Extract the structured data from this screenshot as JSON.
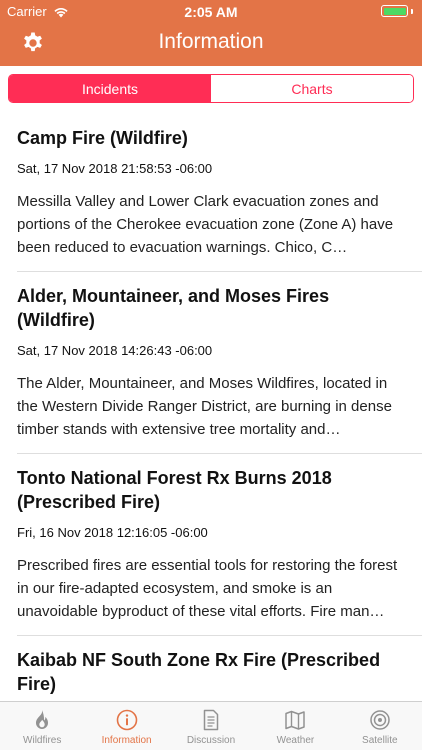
{
  "status_bar": {
    "carrier": "Carrier",
    "time": "2:05 AM",
    "battery_level": 1.0
  },
  "nav": {
    "title": "Information",
    "settings_icon": "gear-icon"
  },
  "segments": [
    {
      "label": "Incidents",
      "active": true
    },
    {
      "label": "Charts",
      "active": false
    }
  ],
  "incidents": [
    {
      "title": "Camp Fire (Wildfire)",
      "date": "Sat, 17 Nov 2018 21:58:53 -06:00",
      "description": " Messilla Valley and Lower Clark evacuation zones and portions of the Cherokee evacuation zone (Zone A) have been reduced to evacuation warnings. Chico, C…"
    },
    {
      "title": "Alder, Mountaineer, and Moses Fires (Wildfire)",
      "date": "Sat, 17 Nov 2018 14:26:43 -06:00",
      "description": "The Alder, Mountaineer, and Moses Wildfires, located in the Western Divide Ranger District, are burning in dense timber stands with extensive tree mortality and…"
    },
    {
      "title": "Tonto National Forest Rx Burns 2018 (Prescribed Fire)",
      "date": "Fri, 16 Nov 2018 12:16:05 -06:00",
      "description": "Prescribed fires are essential tools for restoring the forest in our fire-adapted ecosystem, and smoke is an unavoidable byproduct of these vital efforts. Fire man…"
    },
    {
      "title": "Kaibab NF South Zone Rx Fire (Prescribed Fire)",
      "date": "",
      "description": ""
    }
  ],
  "tabs": [
    {
      "label": "Wildfires",
      "icon": "flame-icon",
      "active": false
    },
    {
      "label": "Information",
      "icon": "info-icon",
      "active": true
    },
    {
      "label": "Discussion",
      "icon": "document-icon",
      "active": false
    },
    {
      "label": "Weather",
      "icon": "map-icon",
      "active": false
    },
    {
      "label": "Satellite",
      "icon": "satellite-icon",
      "active": false
    }
  ],
  "colors": {
    "header": "#e37447",
    "segment_accent": "#ff2d55",
    "tab_active": "#e37447",
    "tab_inactive": "#929292",
    "battery": "#4cd964"
  }
}
